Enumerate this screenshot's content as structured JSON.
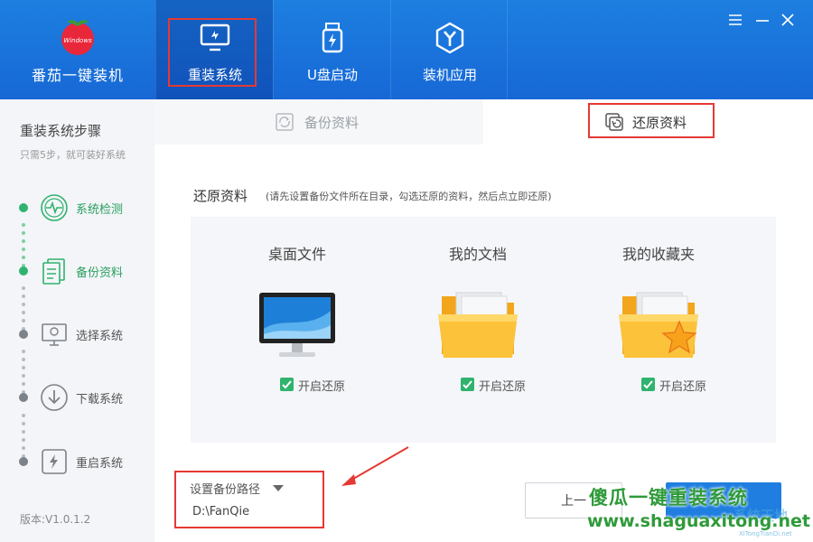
{
  "brand": {
    "name": "番茄一键装机",
    "logo_text": "Windows"
  },
  "nav": {
    "tabs": [
      {
        "label": "重装系统",
        "icon": "monitor-refresh-icon",
        "active": true
      },
      {
        "label": "U盘启动",
        "icon": "usb-bolt-icon",
        "active": false
      },
      {
        "label": "装机应用",
        "icon": "hexagon-y-icon",
        "active": false
      }
    ]
  },
  "window_controls": [
    "menu-icon",
    "minimize-icon",
    "close-icon"
  ],
  "sidebar": {
    "title": "重装系统步骤",
    "subtitle": "只需5步，就可装好系统",
    "steps": [
      {
        "label": "系统检测",
        "icon": "pulse-icon",
        "done": true
      },
      {
        "label": "备份资料",
        "icon": "documents-icon",
        "done": true
      },
      {
        "label": "选择系统",
        "icon": "monitor-icon",
        "done": false
      },
      {
        "label": "下载系统",
        "icon": "download-icon",
        "done": false
      },
      {
        "label": "重启系统",
        "icon": "restart-icon",
        "done": false
      }
    ],
    "version": "版本:V1.0.1.2"
  },
  "subtabs": {
    "backup": {
      "label": "备份资料",
      "icon": "backup-icon"
    },
    "restore": {
      "label": "还原资料",
      "icon": "restore-icon"
    }
  },
  "restore": {
    "title": "还原资料",
    "hint": "(请先设置备份文件所在目录，勾选还原的资料，然后点立即还原)",
    "cards": [
      {
        "title": "桌面文件",
        "icon": "desktop-computer-icon",
        "option": "开启还原",
        "checked": true
      },
      {
        "title": "我的文档",
        "icon": "folder-documents-icon",
        "option": "开启还原",
        "checked": true
      },
      {
        "title": "我的收藏夹",
        "icon": "folder-star-icon",
        "option": "开启还原",
        "checked": true
      }
    ],
    "path_label": "设置备份路径",
    "path_value": "D:\\FanQie",
    "prev_button": "上一"
  },
  "watermark": {
    "line1": "傻瓜一键重装系统",
    "line2": "www.shaguaxitong.net",
    "line3": "系统天地",
    "line4": "XiTongTianDi.net"
  },
  "colors": {
    "header": "#1768d6",
    "accent": "#2fb36e",
    "highlight": "#e53935",
    "primary": "#1f7ee0"
  }
}
